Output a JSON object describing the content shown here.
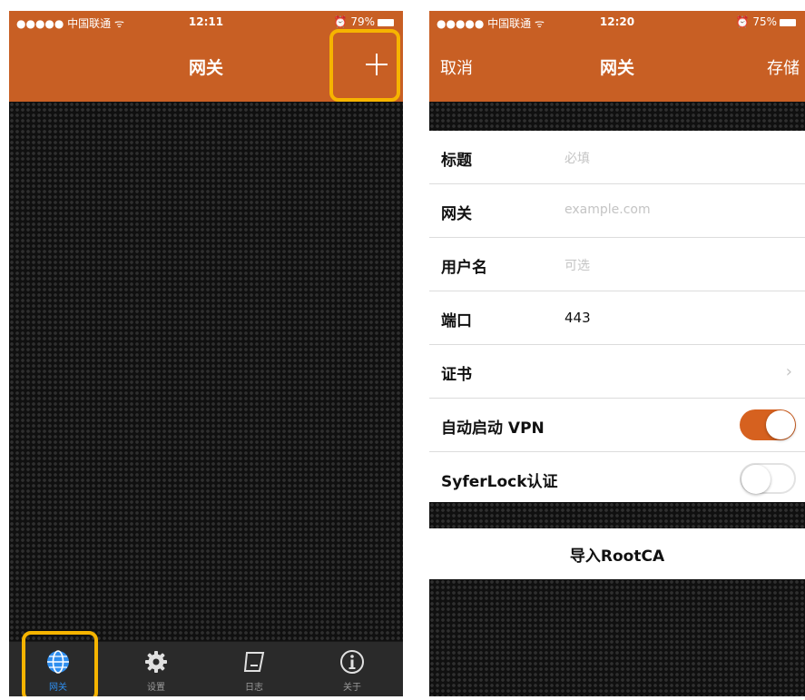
{
  "left": {
    "status": {
      "carrier": "●●●●● 中国联通 ᯤ",
      "time": "12:11",
      "battery": "⏰ 79%"
    },
    "nav": {
      "title": "网关",
      "add_icon": "plus-icon"
    },
    "tabs": [
      {
        "label": "网关",
        "icon": "globe-icon",
        "active": true
      },
      {
        "label": "设置",
        "icon": "gear-icon",
        "active": false
      },
      {
        "label": "日志",
        "icon": "log-icon",
        "active": false
      },
      {
        "label": "关于",
        "icon": "info-icon",
        "active": false
      }
    ],
    "highlight_color": "#f6b400"
  },
  "right": {
    "status": {
      "carrier": "●●●●● 中国联通 ᯤ",
      "time": "12:20",
      "battery": "⏰ 75%"
    },
    "nav": {
      "cancel": "取消",
      "title": "网关",
      "save": "存储"
    },
    "form": {
      "title": {
        "label": "标题",
        "placeholder": "必填"
      },
      "gateway": {
        "label": "网关",
        "placeholder": "example.com"
      },
      "username": {
        "label": "用户名",
        "placeholder": "可选"
      },
      "port": {
        "label": "端口",
        "value": "443"
      },
      "certificate": {
        "label": "证书",
        "icon": "chevron-right-icon"
      },
      "auto_vpn": {
        "label": "自动启动 VPN",
        "on": true
      },
      "syferlock": {
        "label": "SyferLock认证",
        "on": false
      }
    },
    "import_button": "导入RootCA"
  },
  "colors": {
    "navbar": "#c85f24",
    "toggle_on": "#d6611f",
    "active_tab": "#2f8ff0"
  }
}
